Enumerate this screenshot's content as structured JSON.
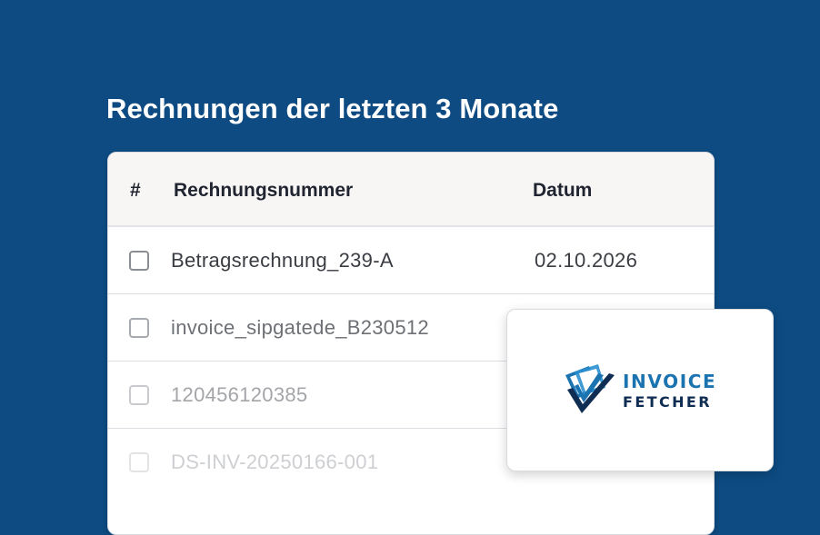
{
  "heading": "Rechnungen der letzten 3 Monate",
  "table": {
    "headers": {
      "index": "#",
      "number": "Rechnungsnummer",
      "date": "Datum"
    },
    "rows": [
      {
        "number": "Betragsrechnung_239-A",
        "date": "02.10.2026",
        "checked": false
      },
      {
        "number": "invoice_sipgatede_B230512",
        "date": "",
        "checked": false
      },
      {
        "number": "120456120385",
        "date": "",
        "checked": false
      },
      {
        "number": "DS-INV-20250166-001",
        "date": "",
        "checked": false
      }
    ]
  },
  "logo": {
    "line1": "INVOICE",
    "line2": "FETCHER",
    "icon": "invoice-fetcher-logo-icon"
  },
  "colors": {
    "background": "#0d4b82",
    "logo_blue": "#1b74b0",
    "logo_navy": "#0f2d52"
  }
}
